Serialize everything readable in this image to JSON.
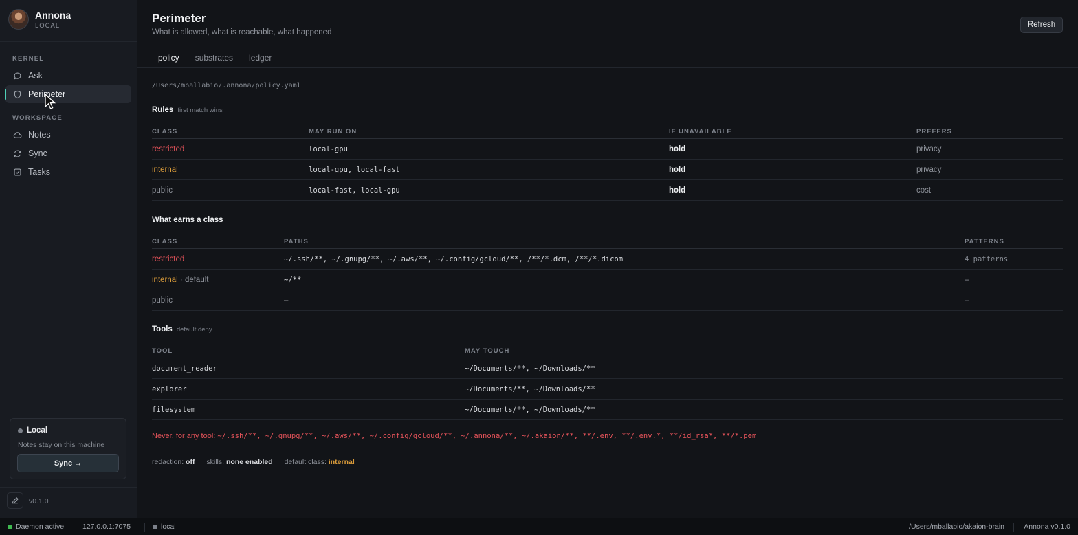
{
  "app": {
    "name": "Annona",
    "mode": "LOCAL"
  },
  "sidebar": {
    "sections": [
      {
        "title": "KERNEL",
        "items": [
          {
            "label": "Ask",
            "icon": "chat-bubble-icon"
          },
          {
            "label": "Perimeter",
            "icon": "shield-icon",
            "active": true
          }
        ]
      },
      {
        "title": "WORKSPACE",
        "items": [
          {
            "label": "Notes",
            "icon": "cloud-icon"
          },
          {
            "label": "Sync",
            "icon": "refresh-icon"
          },
          {
            "label": "Tasks",
            "icon": "checkbox-icon"
          }
        ]
      }
    ],
    "sync_card": {
      "title": "Local",
      "subtitle": "Notes stay on this machine",
      "button": "Sync →"
    },
    "version": "v0.1.0"
  },
  "header": {
    "title": "Perimeter",
    "subtitle": "What is allowed, what is reachable, what happened",
    "refresh_label": "Refresh"
  },
  "tabs": [
    {
      "label": "policy",
      "active": true
    },
    {
      "label": "substrates"
    },
    {
      "label": "ledger"
    }
  ],
  "policy": {
    "path": "/Users/mballabio/.annona/policy.yaml",
    "rules": {
      "title": "Rules",
      "note": "first match wins",
      "columns": [
        "CLASS",
        "MAY RUN ON",
        "IF UNAVAILABLE",
        "PREFERS"
      ],
      "rows": [
        {
          "class": "restricted",
          "may_run_on": "local-gpu",
          "if_unavailable": "hold",
          "prefers": "privacy"
        },
        {
          "class": "internal",
          "may_run_on": "local-gpu, local-fast",
          "if_unavailable": "hold",
          "prefers": "privacy"
        },
        {
          "class": "public",
          "may_run_on": "local-fast, local-gpu",
          "if_unavailable": "hold",
          "prefers": "cost"
        }
      ]
    },
    "earns": {
      "title": "What earns a class",
      "columns": [
        "CLASS",
        "PATHS",
        "PATTERNS"
      ],
      "rows": [
        {
          "class": "restricted",
          "suffix": "",
          "paths": "~/.ssh/**, ~/.gnupg/**, ~/.aws/**, ~/.config/gcloud/**, /**/*.dcm, /**/*.dicom",
          "patterns": "4 patterns"
        },
        {
          "class": "internal",
          "suffix": "· default",
          "paths": "~/**",
          "patterns": "–"
        },
        {
          "class": "public",
          "suffix": "",
          "paths": "–",
          "patterns": "–"
        }
      ]
    },
    "tools": {
      "title": "Tools",
      "note": "default deny",
      "columns": [
        "TOOL",
        "MAY TOUCH"
      ],
      "rows": [
        {
          "tool": "document_reader",
          "may_touch": "~/Documents/**, ~/Downloads/**"
        },
        {
          "tool": "explorer",
          "may_touch": "~/Documents/**, ~/Downloads/**"
        },
        {
          "tool": "filesystem",
          "may_touch": "~/Documents/**, ~/Downloads/**"
        }
      ]
    },
    "never": {
      "label": "Never, for any tool:",
      "paths": "~/.ssh/**, ~/.gnupg/**, ~/.aws/**, ~/.config/gcloud/**, ~/.annona/**, ~/.akaion/**, **/.env, **/.env.*, **/id_rsa*, **/*.pem"
    },
    "footer": {
      "redaction_label": "redaction:",
      "redaction_value": "off",
      "skills_label": "skills:",
      "skills_value": "none enabled",
      "default_class_label": "default class:",
      "default_class_value": "internal"
    }
  },
  "statusbar": {
    "daemon": "Daemon active",
    "address": "127.0.0.1:7075",
    "mode": "local",
    "path": "/Users/mballabio/akaion-brain",
    "version": "Annona v0.1.0"
  },
  "colors": {
    "accent": "#4fd1b8",
    "restricted": "#e5535a",
    "internal": "#d99b3a",
    "public": "#8d9199",
    "status_ok": "#3fb950"
  }
}
